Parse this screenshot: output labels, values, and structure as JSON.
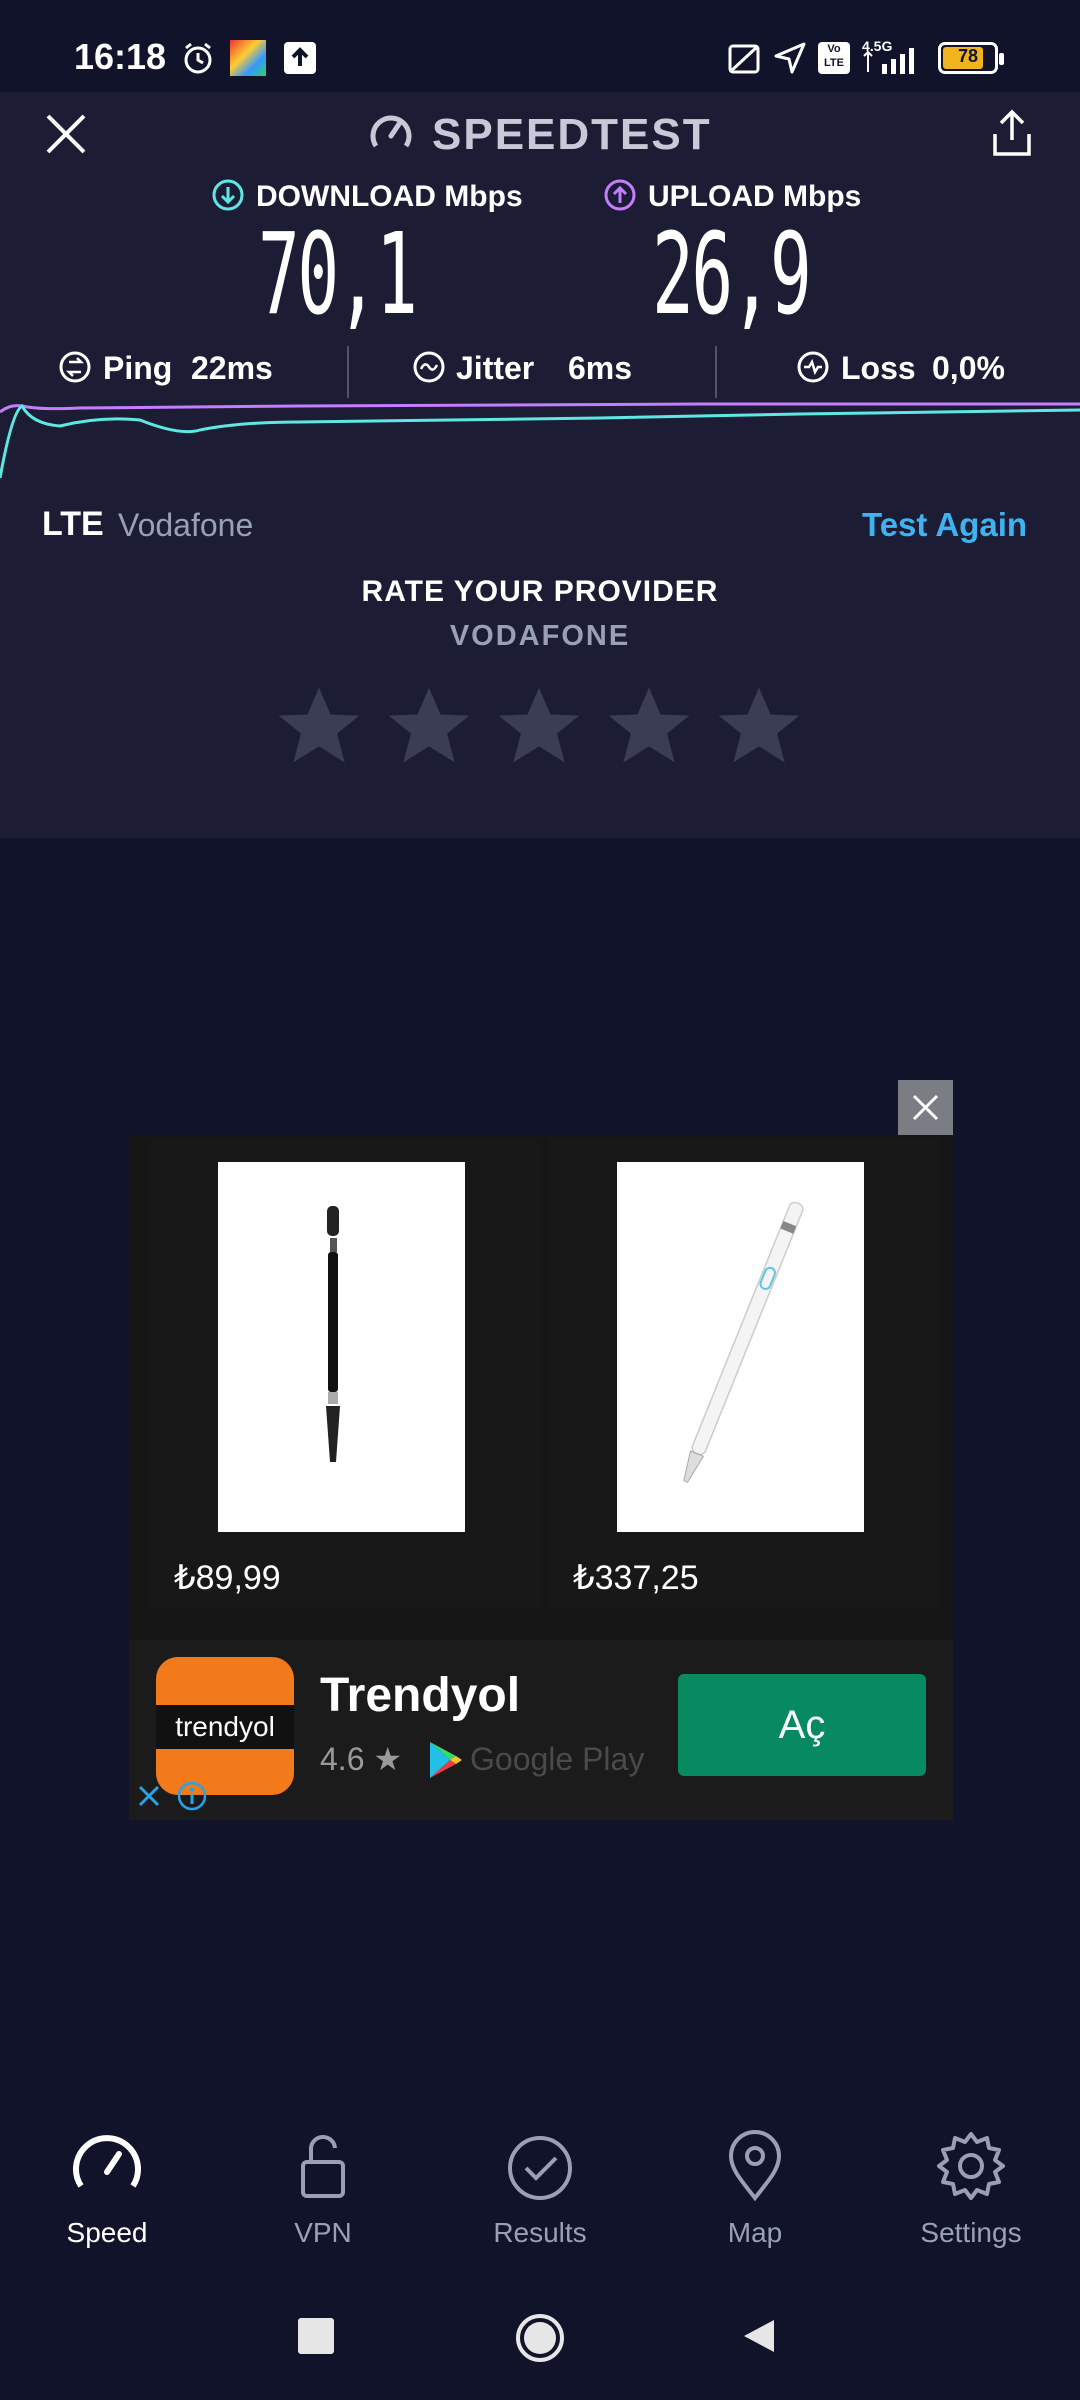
{
  "status_bar": {
    "time": "16:18",
    "network": "4.5G",
    "battery": "78"
  },
  "header": {
    "title": "SPEEDTEST",
    "close_icon": "close-icon",
    "share_icon": "share-icon"
  },
  "metrics": {
    "download_label": "DOWNLOAD Mbps",
    "download_value": "70,1",
    "upload_label": "UPLOAD Mbps",
    "upload_value": "26,9",
    "ping_label": "Ping",
    "ping_value": "22ms",
    "jitter_label": "Jitter",
    "jitter_value": "6ms",
    "loss_label": "Loss",
    "loss_value": "0,0%"
  },
  "connection": {
    "type": "LTE",
    "operator": "Vodafone",
    "test_again": "Test Again"
  },
  "rating": {
    "title": "RATE YOUR PROVIDER",
    "provider": "VODAFONE",
    "stars_selected": 0,
    "stars_total": 5
  },
  "ad": {
    "products": [
      {
        "price": "₺89,99"
      },
      {
        "price": "₺337,25"
      }
    ],
    "advertiser": "Trendyol",
    "logo_text": "trendyol",
    "rating": "4.6",
    "store": "Google Play",
    "cta": "Aç"
  },
  "bottom_nav": {
    "items": [
      {
        "label": "Speed",
        "icon": "speedometer-icon",
        "active": true
      },
      {
        "label": "VPN",
        "icon": "lock-icon",
        "active": false
      },
      {
        "label": "Results",
        "icon": "check-circle-icon",
        "active": false
      },
      {
        "label": "Map",
        "icon": "map-pin-icon",
        "active": false
      },
      {
        "label": "Settings",
        "icon": "gear-icon",
        "active": false
      }
    ]
  },
  "colors": {
    "background": "#11132a",
    "panel": "#1c1d35",
    "download_accent": "#5ee8e4",
    "upload_accent": "#c57dff",
    "link": "#3fb2f0",
    "cta_green": "#078a5f",
    "brand_orange": "#f27a1a"
  }
}
